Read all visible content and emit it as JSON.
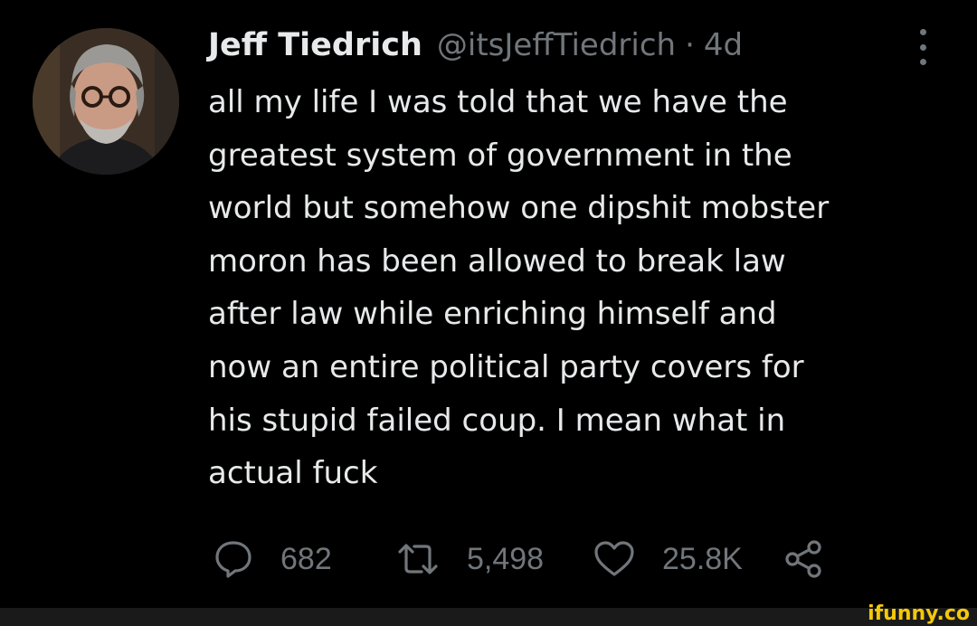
{
  "tweet": {
    "author_name": "Jeff Tiedrich",
    "handle": "@itsJeffTiedrich",
    "separator": "·",
    "time": "4d",
    "text_lines": [
      "all my life I was told that we have the",
      "greatest system of government in the",
      "world but somehow one dipshit mobster",
      "moron has been allowed to break law",
      "after law while enriching himself and",
      "now an entire political party covers for",
      "his stupid failed coup. I mean what in",
      "actual fuck"
    ],
    "replies": "682",
    "retweets": "5,498",
    "likes": "25.8K"
  },
  "icons": {
    "more": "more-vertical-icon",
    "reply": "reply-icon",
    "retweet": "retweet-icon",
    "like": "heart-icon",
    "share": "share-icon"
  },
  "watermark": "ifunny.co",
  "colors": {
    "background": "#000000",
    "text": "#e7e9ea",
    "secondary": "#71767b",
    "watermark": "#f4c80a"
  }
}
